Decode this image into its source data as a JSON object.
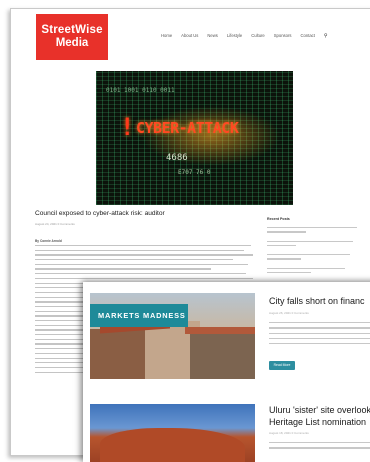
{
  "logo": {
    "line1": "StreetWise",
    "line2": "Media",
    "color": "#e8312a"
  },
  "nav": {
    "items": [
      "Home",
      "About Us",
      "News",
      "Lifestyle",
      "Culture",
      "Sponsors",
      "Contact"
    ],
    "search_icon": "search-icon"
  },
  "hero": {
    "code_top": "0101 1001 0110 0011",
    "warning_glyph": "!",
    "cyber_text": "CYBER-ATTACK",
    "code_mid": "4686",
    "code_low": "E707 76 0"
  },
  "article": {
    "title": "Council exposed to cyber-attack risk: auditor",
    "meta": "August 24, 2021   0 Comments",
    "byline": "By Connie Arnold"
  },
  "sidebar": {
    "heading": "Recent Posts"
  },
  "front": {
    "tag": "MARKETS MADNESS",
    "post1_title": "City falls short on financ",
    "post1_meta": "August 26, 2021   0 Comments",
    "read_more": "Read More",
    "post2_title_line1": "Uluru 'sister' site overlook",
    "post2_title_line2": "Heritage List nomination",
    "post2_meta": "August 18, 2021   0 Comments"
  },
  "colors": {
    "accent": "#1e8a99",
    "brand": "#e8312a"
  }
}
